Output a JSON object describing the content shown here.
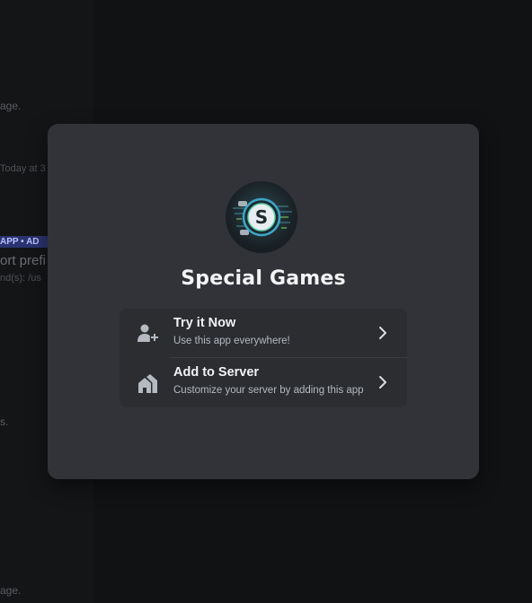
{
  "background": {
    "fragments": [
      {
        "text": "age."
      },
      {
        "text": "Today at 3"
      },
      {
        "text": "APP • AD"
      },
      {
        "text": "ort prefi"
      },
      {
        "text": "nd(s): /us"
      },
      {
        "text": "s."
      },
      {
        "text": "age."
      }
    ]
  },
  "modal": {
    "app_name": "Special Games",
    "avatar_letter": "S",
    "options": [
      {
        "title": "Try it Now",
        "subtitle": "Use this app everywhere!",
        "icon": "user-add-icon"
      },
      {
        "title": "Add to Server",
        "subtitle": "Customize your server by adding this app",
        "icon": "server-add-icon"
      }
    ]
  },
  "colors": {
    "modal_bg": "#313338",
    "options_bg": "#2b2d31",
    "title_text": "#f2f3f5",
    "sub_text": "#b5bac1",
    "icon_color": "#b5bac1",
    "tag_bg": "#2c3470"
  }
}
